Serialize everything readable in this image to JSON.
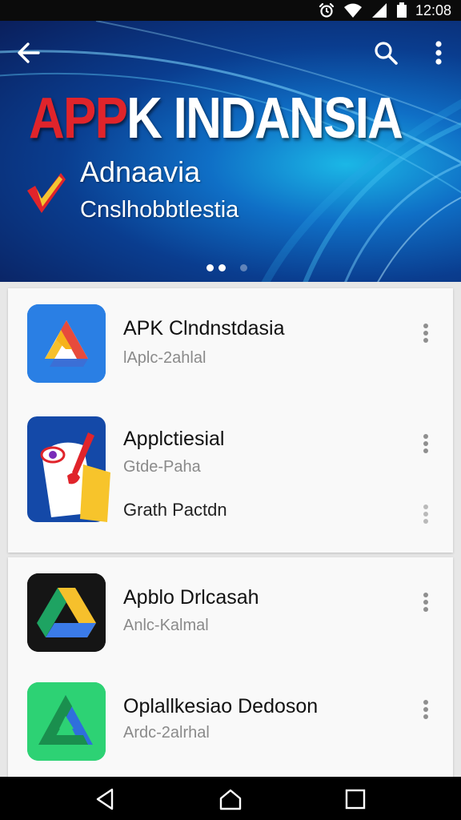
{
  "status_bar": {
    "time": "12:08"
  },
  "hero": {
    "title_red": "APP",
    "title_white": "K INDANSIA",
    "line1": "Adnaavia",
    "line2": "Cnslhobbtlestia",
    "colors": {
      "accent_red": "#e0242b",
      "hero_blue": "#0f6fc6"
    }
  },
  "apps_group1": [
    {
      "title": "APK Clndnstdasia",
      "subtitle": "lAplc-2ahlal",
      "icon": "drive-triangle-icon"
    },
    {
      "title": "Applctiesial",
      "subtitle": "Gtde-Paha",
      "extra": "Grath Pactdn",
      "icon": "paint-palette-icon"
    }
  ],
  "apps_group2": [
    {
      "title": "Apblo Drlcasah",
      "subtitle": "Anlc-Kalmal",
      "icon": "drive-logo-dark-icon"
    },
    {
      "title": "Oplallkesiao Dedoson",
      "subtitle": "Ardc-2alrhal",
      "icon": "drive-logo-green-icon"
    }
  ],
  "icons": {
    "back": "back-arrow-icon",
    "search": "search-icon",
    "more": "more-vert-icon",
    "nav_back": "nav-back-icon",
    "nav_home": "nav-home-icon",
    "nav_recents": "nav-recents-icon"
  }
}
